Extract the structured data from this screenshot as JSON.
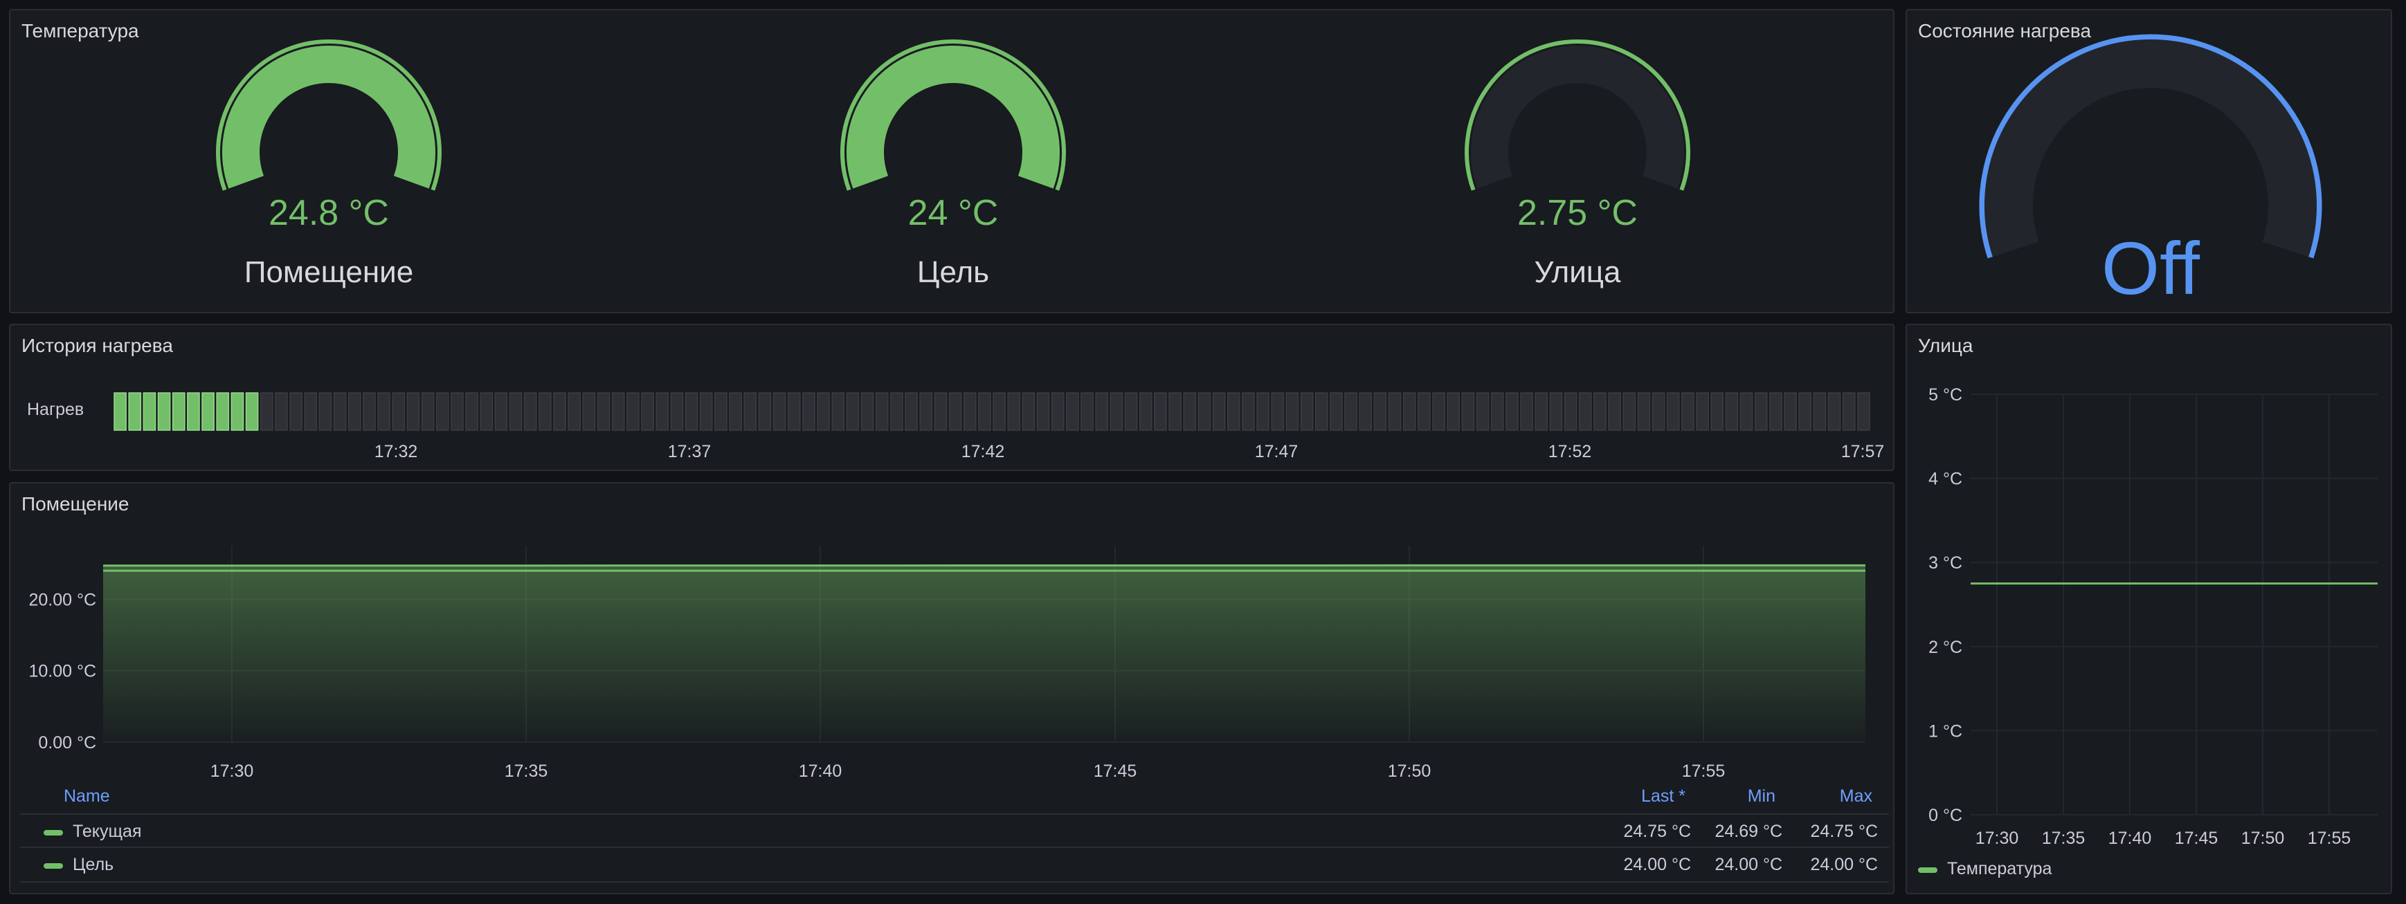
{
  "panels": {
    "temperature": {
      "title": "Температура",
      "gauges": [
        {
          "value": "24.8 °C",
          "label": "Помещение",
          "fill_fraction": 1.0,
          "color": "#73bf69"
        },
        {
          "value": "24 °C",
          "label": "Цель",
          "fill_fraction": 1.0,
          "color": "#73bf69"
        },
        {
          "value": "2.75 °C",
          "label": "Улица",
          "fill_fraction": 0.0,
          "color": "#73bf69"
        }
      ]
    },
    "heating_state": {
      "title": "Состояние нагрева",
      "value": "Off",
      "color": "#5794f2"
    },
    "heating_history": {
      "title": "История нагрева",
      "row_label": "Нагрев",
      "total_segments": 120,
      "active_segments": 10,
      "time_labels": [
        "17:32",
        "17:37",
        "17:42",
        "17:47",
        "17:52",
        "17:57"
      ],
      "active_color": "#73bf69",
      "inactive_color": "#2f3035"
    },
    "room": {
      "title": "Помещение",
      "y_ticks": [
        "20.00 °C",
        "10.00 °C",
        "0.00 °C"
      ],
      "x_ticks": [
        "17:30",
        "17:35",
        "17:40",
        "17:45",
        "17:50",
        "17:55"
      ],
      "legend": {
        "headers": {
          "name": "Name",
          "last": "Last *",
          "min": "Min",
          "max": "Max"
        },
        "rows": [
          {
            "name": "Текущая",
            "last": "24.75 °C",
            "min": "24.69 °C",
            "max": "24.75 °C",
            "color": "#73bf69"
          },
          {
            "name": "Цель",
            "last": "24.00 °C",
            "min": "24.00 °C",
            "max": "24.00 °C",
            "color": "#73bf69"
          }
        ]
      }
    },
    "outside": {
      "title": "Улица",
      "y_ticks": [
        "5 °C",
        "4 °C",
        "3 °C",
        "2 °C",
        "1 °C",
        "0 °C"
      ],
      "x_ticks": [
        "17:30",
        "17:35",
        "17:40",
        "17:45",
        "17:50",
        "17:55"
      ],
      "legend_label": "Температура"
    }
  },
  "chart_data": [
    {
      "type": "area",
      "title": "Помещение",
      "x": [
        "17:30",
        "17:35",
        "17:40",
        "17:45",
        "17:50",
        "17:55"
      ],
      "ylim": [
        0,
        27.5
      ],
      "series": [
        {
          "name": "Текущая",
          "values": [
            24.72,
            24.72,
            24.73,
            24.74,
            24.75,
            24.75
          ]
        },
        {
          "name": "Цель",
          "values": [
            24.0,
            24.0,
            24.0,
            24.0,
            24.0,
            24.0
          ]
        }
      ]
    },
    {
      "type": "line",
      "title": "Улица",
      "x": [
        "17:30",
        "17:35",
        "17:40",
        "17:45",
        "17:50",
        "17:55"
      ],
      "ylim": [
        0,
        5
      ],
      "series": [
        {
          "name": "Температура",
          "values": [
            2.75,
            2.75,
            2.75,
            2.75,
            2.75,
            2.75
          ]
        }
      ]
    }
  ]
}
